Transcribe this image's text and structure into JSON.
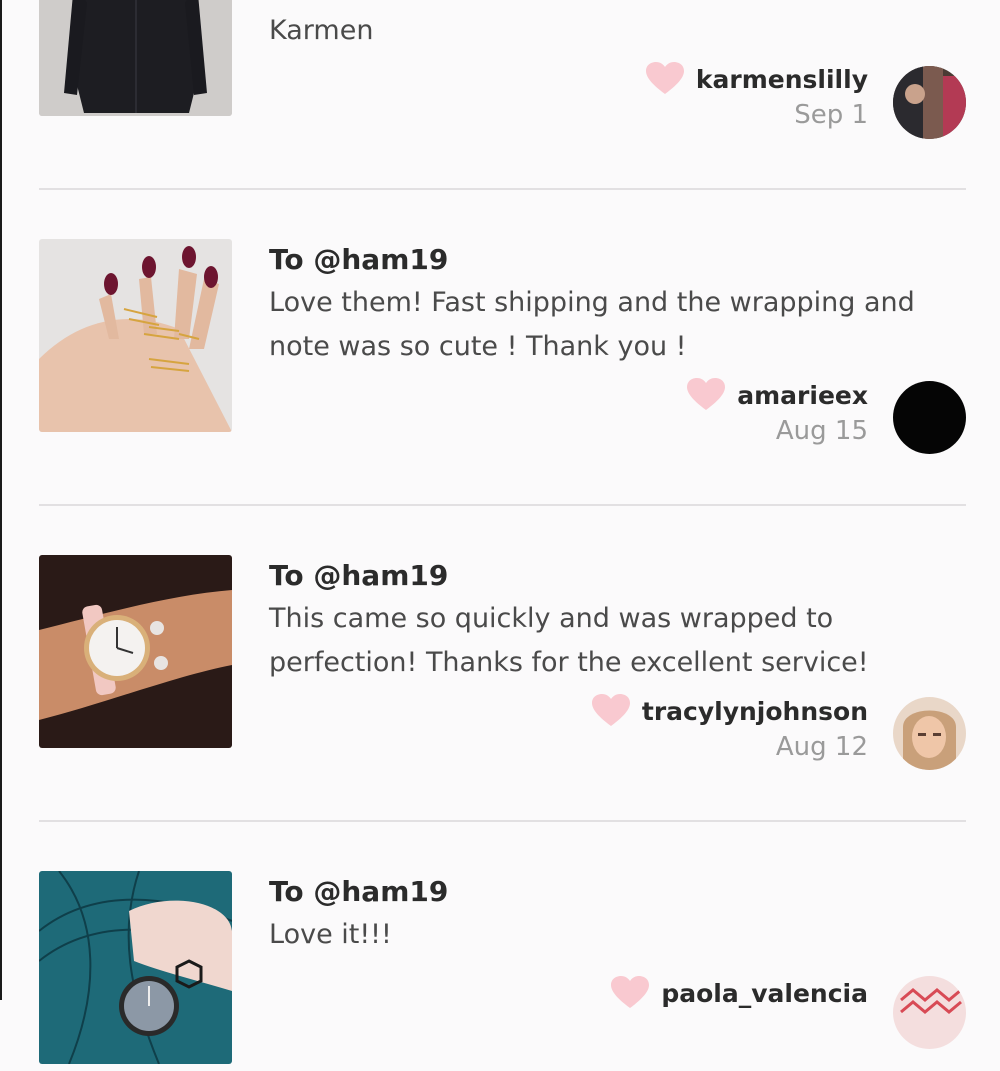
{
  "accent_heart_color": "#f9c9d0",
  "reviews": [
    {
      "to": "",
      "text": "Karmen",
      "username": "karmenslilly",
      "date": "Sep 1",
      "thumb_icon": "black-coat-photo",
      "avatar_icon": "user-avatar-karmenslilly"
    },
    {
      "to": "To @ham19",
      "text": "Love them! Fast shipping and the wrapping and note was so cute ! Thank you !",
      "username": "amarieex",
      "date": "Aug 15",
      "thumb_icon": "rings-on-hand-photo",
      "avatar_icon": "user-avatar-amarieex"
    },
    {
      "to": "To @ham19",
      "text": "This came so quickly and was wrapped to perfection! Thanks for the excellent service!",
      "username": "tracylynjohnson",
      "date": "Aug 12",
      "thumb_icon": "watch-on-wrist-photo",
      "avatar_icon": "user-avatar-tracylynjohnson"
    },
    {
      "to": "To @ham19",
      "text": "Love it!!!",
      "username": "paola_valencia",
      "date": "",
      "thumb_icon": "watch-peacock-photo",
      "avatar_icon": "user-avatar-paola-valencia"
    }
  ]
}
